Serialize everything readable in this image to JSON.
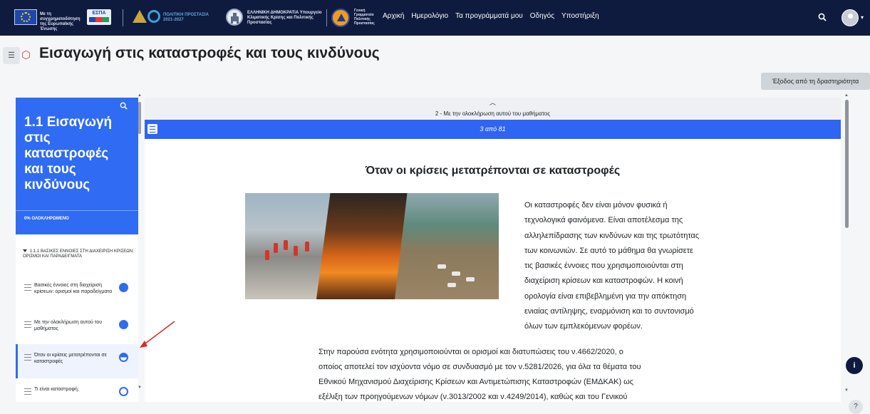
{
  "topbar": {
    "logo_eu_text": "Με τη συγχρηματοδότηση της Ευρωπαϊκής Ένωσης",
    "espa_label": "ΕΣΠΑ",
    "program_text": "ΠΟΛΙΤΙΚΗ ΠΡΟΣΤΑΣΙΑ 2021-2027",
    "ministry_text": "ΕΛΛΗΝΙΚΗ ΔΗΜΟΚΡΑΤΙΑ Υπουργείο Κλιματικής Κρίσης και Πολιτικής Προστασίας",
    "civil_protection_text": "Γενική Γραμματεία Πολιτικής Προστασίας",
    "nav": [
      "Αρχική",
      "Ημερολόγιο",
      "Τα προγράμματά μου",
      "Οδηγός",
      "Υποστήριξη"
    ],
    "colors": {
      "bg": "#0f1a3f",
      "accent": "#2e65f3"
    },
    "icons": [
      "search-icon",
      "avatar-icon",
      "chevron-down-icon"
    ]
  },
  "page": {
    "title": "Εισαγωγή στις καταστροφές και τους κινδύνους",
    "exit_label": "Έξοδος από τη δραστηριότητα"
  },
  "sidebar": {
    "hero_title": "1.1 Εισαγωγή στις καταστροφές και τους κινδύνους",
    "progress": "0% ΟΛΟΚΛΗΡΩΜΕΝΟ",
    "section_heading": "1.1.1 ΒΑΣΙΚΕΣ ΕΝΝΟΙΕΣ ΣΤΗ ΔΙΑΧΕΙΡΙΣΗ ΚΡΙΣΕΩΝ: ΟΡΙΣΜΟΙ ΚΑΙ ΠΑΡΑΔΕΙΓΜΑΤΑ",
    "items": [
      {
        "label": "Βασικές έννοιες στη διαχείριση κρίσεων: ορισμοί και παραδείγματα",
        "status": "complete"
      },
      {
        "label": "Με την ολοκλήρωση αυτού του μαθήματος",
        "status": "complete"
      },
      {
        "label": "Όταν οι κρίσεις μετατρέπονται σε καταστροφές",
        "status": "current"
      },
      {
        "label": "Τι είναι καταστροφή;",
        "status": "empty"
      }
    ]
  },
  "content": {
    "previous_label": "2 - Με την ολοκλήρωση αυτού του μαθήματος",
    "pager": "3 από 81",
    "section_title": "Όταν οι κρίσεις μετατρέπονται σε καταστροφές",
    "intro_lines": [
      "Οι καταστροφές δεν είναι μόνον φυσικά ή",
      "τεχνολογικά φαινόμενα. Είναι αποτέλεσμα της",
      "αλληλεπίδρασης των κινδύνων και της τρωτότητας",
      "των κοινωνιών. Σε αυτό το μάθημα θα γνωρίσετε",
      "τις βασικές έννοιες που χρησιμοποιούνται στη",
      "διαχείριση κρίσεων και καταστροφών. Η κοινή",
      "ορολογία είναι επιβεβλημένη για την απόκτηση",
      "ενιαίας αντίληψης, εναρμόνιση και το συντονισμό",
      "όλων των εμπλεκόμενων φορέων."
    ],
    "body_lines": [
      "Στην παρούσα ενότητα χρησιμοποιούνται οι ορισμοί και διατυπώσεις του ν.4662/2020, ο",
      "οποίος αποτελεί τον ισχύοντα νόμο σε συνδυασμό με τον ν.5281/2026, για όλα τα θέματα του",
      "Εθνικού Μηχανισμού Διαχείρισης Κρίσεων και Αντιμετώπισης Καταστροφών (ΕΜΔΚΑΚ) ως",
      "εξέλιξη των προηγούμενων νόμων (ν.3013/2002 και ν.4249/2014), καθώς και του Γενικού"
    ]
  }
}
